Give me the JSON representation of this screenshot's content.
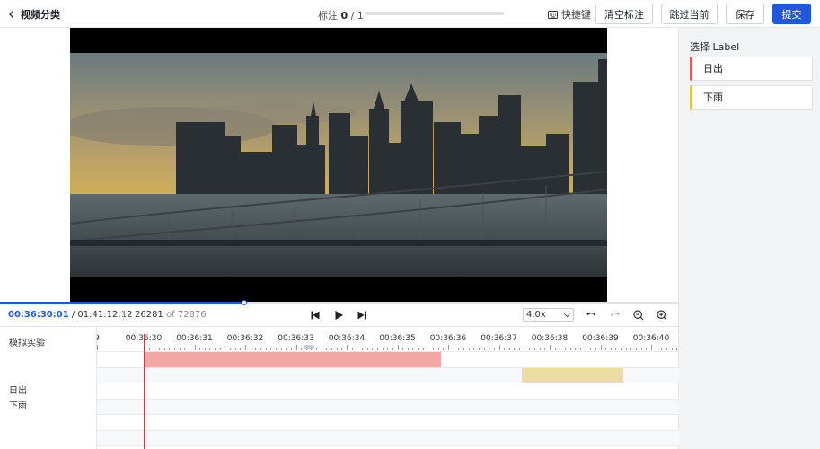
{
  "header": {
    "back_label": "视频分类",
    "counter_prefix": "标注",
    "counter_current": "0",
    "counter_sep": "/",
    "counter_total": "1",
    "progress_fraction": 0,
    "shortcut_label": "快捷键",
    "buttons": {
      "clear": "清空标注",
      "skip": "跳过当前",
      "save": "保存",
      "submit": "提交"
    }
  },
  "player": {
    "current_time": "00:36:30:01",
    "time_sep": "/",
    "total_time": "01:41:12:12",
    "frame_current": "26281",
    "frame_of": "of",
    "frame_total": "72876",
    "played_fraction": 0.36,
    "speed": "4.0x"
  },
  "timeline": {
    "header_label": "模拟实验",
    "ticks": [
      "9",
      "00:36:30",
      "00:36:31",
      "00:36:32",
      "00:36:33",
      "00:36:34",
      "00:36:35",
      "00:36:36",
      "00:36:37",
      "00:36:38",
      "00:36:39",
      "00:36:40"
    ],
    "tracks": [
      {
        "label": "日出",
        "color": "#f2a9a6",
        "start_sec": 0,
        "end_sec": 5.85
      },
      {
        "label": "下雨",
        "color": "#eddca3",
        "start_sec": 7.45,
        "end_sec": 9.45
      }
    ],
    "empty_rows": 5
  },
  "labels_panel": {
    "title": "选择 Label",
    "items": [
      {
        "text": "日出",
        "color": "#e05a55"
      },
      {
        "text": "下雨",
        "color": "#e3c44a"
      }
    ]
  },
  "colors": {
    "accent": "#2158d9",
    "cursor": "#e0363b"
  },
  "icons": {
    "back": "chevron-left-icon",
    "keyboard": "keyboard-icon",
    "prev": "skip-back-icon",
    "play": "play-icon",
    "next": "skip-forward-icon",
    "undo": "undo-icon",
    "redo": "redo-icon",
    "zoom_out": "zoom-out-icon",
    "zoom_in": "zoom-in-icon"
  }
}
